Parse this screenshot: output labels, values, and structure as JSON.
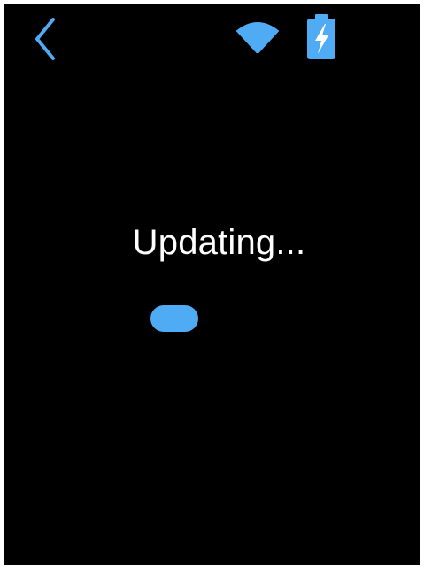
{
  "colors": {
    "background": "#000000",
    "accent": "#4eabf4",
    "text": "#ffffff"
  },
  "status_bar": {
    "back_icon": "chevron-left-icon",
    "wifi_icon": "wifi-icon",
    "battery_icon": "battery-charging-icon"
  },
  "main": {
    "status_text": "Updating..."
  }
}
